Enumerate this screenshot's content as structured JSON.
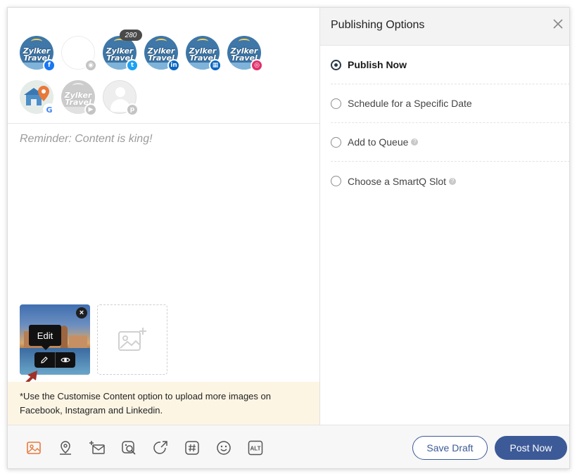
{
  "profiles": [
    {
      "name": "zylker-facebook",
      "logo": "Zylker Travel",
      "network": "facebook",
      "badge": "f"
    },
    {
      "name": "facebook-group",
      "logo": "",
      "network": "group",
      "badge": "◉"
    },
    {
      "name": "zylker-twitter",
      "logo": "Zylker Travel",
      "network": "twitter",
      "badge": "t",
      "count": "280"
    },
    {
      "name": "zylker-linkedin",
      "logo": "Zylker Travel",
      "network": "linkedin",
      "badge": "in"
    },
    {
      "name": "zylker-linkedin-page",
      "logo": "Zylker Travel",
      "network": "linkedin-page",
      "badge": "▦"
    },
    {
      "name": "zylker-instagram",
      "logo": "Zylker Travel",
      "network": "instagram",
      "badge": "◎"
    },
    {
      "name": "google-my-business",
      "logo": "",
      "network": "google",
      "badge": "G"
    },
    {
      "name": "zylker-youtube",
      "logo": "Zylker Travel",
      "network": "youtube",
      "badge": "▶"
    },
    {
      "name": "pinterest",
      "logo": "",
      "network": "pinterest",
      "badge": "p"
    }
  ],
  "composer": {
    "placeholder": "Reminder: Content is king!"
  },
  "media": {
    "tooltip": "Edit",
    "close": "×",
    "notice": "*Use the Customise Content option to upload more images on Facebook, Instagram and Linkedin."
  },
  "panel": {
    "title": "Publishing Options",
    "options": [
      {
        "label": "Publish Now",
        "selected": true,
        "help": false
      },
      {
        "label": "Schedule for a Specific Date",
        "selected": false,
        "help": false
      },
      {
        "label": "Add to Queue",
        "selected": false,
        "help": true
      },
      {
        "label": "Choose a SmartQ Slot",
        "selected": false,
        "help": true
      }
    ]
  },
  "toolbar": {
    "icons": [
      "image-icon",
      "location-icon",
      "add-mail-icon",
      "image-search-icon",
      "share-link-icon",
      "hashtag-icon",
      "emoji-icon",
      "alt-text-icon"
    ],
    "alt_label": "ALT"
  },
  "buttons": {
    "save_draft": "Save Draft",
    "post_now": "Post Now"
  },
  "colors": {
    "primary": "#3d5a98",
    "accent": "#e8793a",
    "notice_bg": "#fdf5e4"
  }
}
